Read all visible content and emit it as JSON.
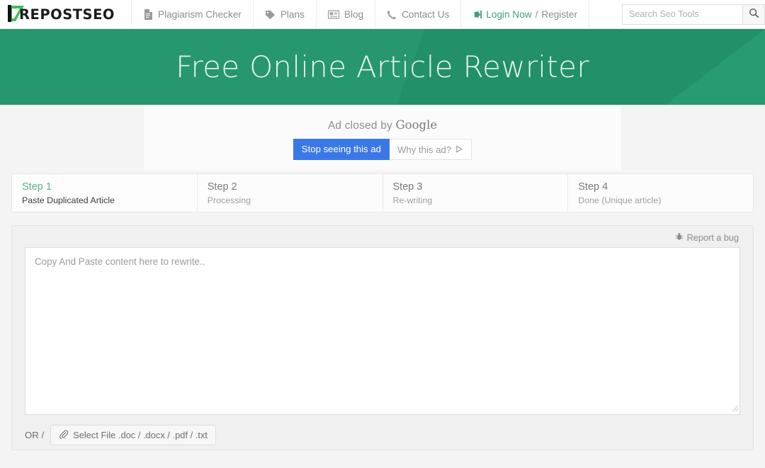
{
  "brand": {
    "name": "REPOSTSEO",
    "logo_icon": "green-p-arrow-logo"
  },
  "nav": {
    "items": [
      {
        "label": "Plagiarism Checker",
        "icon": "document-check-icon"
      },
      {
        "label": "Plans",
        "icon": "tag-icon"
      },
      {
        "label": "Blog",
        "icon": "newspaper-icon"
      },
      {
        "label": "Contact Us",
        "icon": "phone-icon"
      }
    ],
    "login": {
      "icon": "login-arrow-icon",
      "label": "Login Now",
      "separator": "/",
      "register_label": "Register"
    }
  },
  "search": {
    "placeholder": "Search Seo Tools",
    "value": "",
    "button_icon": "search-icon"
  },
  "hero": {
    "title": "Free Online Article Rewriter",
    "bg_color": "#26976e",
    "text_color": "#e6f4ee"
  },
  "ad": {
    "closed_text": "Ad closed by",
    "brand": "Google",
    "stop_button": "Stop seeing this ad",
    "stop_button_color": "#3b78e7",
    "why_button": "Why this ad?",
    "why_icon": "play-triangle-icon"
  },
  "steps": [
    {
      "title": "Step 1",
      "subtitle": "Paste Duplicated Article",
      "active": true
    },
    {
      "title": "Step 2",
      "subtitle": "Processing",
      "active": false
    },
    {
      "title": "Step 3",
      "subtitle": "Re-writing",
      "active": false
    },
    {
      "title": "Step 4",
      "subtitle": "Done (Unique article)",
      "active": false
    }
  ],
  "tool": {
    "report_bug": "Report a bug",
    "report_bug_icon": "bug-icon",
    "textarea_placeholder": "Copy And Paste content here to rewrite..",
    "textarea_value": "",
    "or_label": "OR /",
    "file_button": "Select File .doc / .docx / .pdf / .txt",
    "file_button_icon": "paperclip-icon"
  },
  "theme": {
    "accent_green": "#3f9f76",
    "step_active_green": "#5cb485",
    "page_bg": "#f4f4f4"
  }
}
